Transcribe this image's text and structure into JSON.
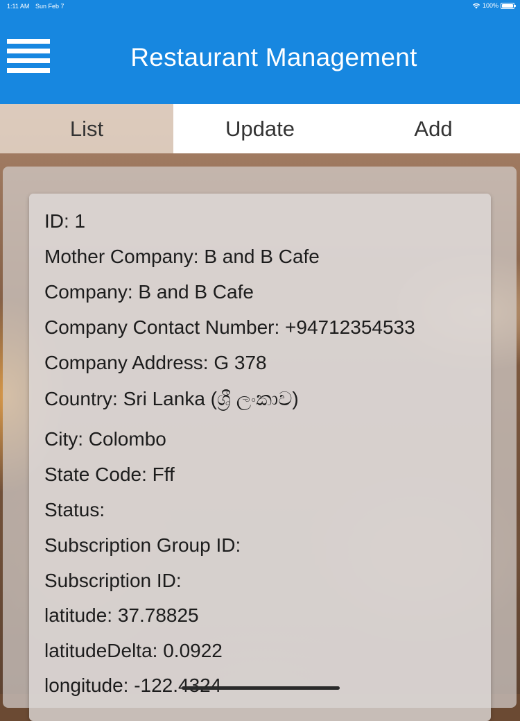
{
  "status_bar": {
    "time": "1:11 AM",
    "date": "Sun Feb 7",
    "battery": "100%"
  },
  "header": {
    "title": "Restaurant Management",
    "menu_icon": "hamburger-menu-icon"
  },
  "tabs": [
    {
      "label": "List",
      "active": true
    },
    {
      "label": "Update",
      "active": false
    },
    {
      "label": "Add",
      "active": false
    }
  ],
  "restaurant": {
    "fields": [
      "ID: 1",
      "Mother Company: B and B Cafe",
      "Company: B and B Cafe",
      "Company Contact Number: +94712354533",
      "Company Address: G 378",
      "Country: Sri Lanka (ශ්‍රී ලංකාව)",
      "City: Colombo",
      "State Code: Fff",
      "Status:",
      "Subscription Group ID:",
      "Subscription ID:",
      "latitude: 37.78825",
      "latitudeDelta: 0.0922",
      "longitude: -122.4324"
    ]
  },
  "colors": {
    "header_blue": "#1787e0",
    "tab_active_bg": "#e8dace",
    "tab_inactive_bg": "#ffffff"
  }
}
